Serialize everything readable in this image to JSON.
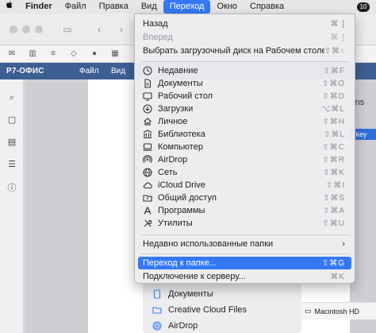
{
  "menubar": {
    "app": "Finder",
    "items": [
      "Файл",
      "Правка",
      "Вид",
      "Переход",
      "Окно",
      "Справка"
    ],
    "badge": "10"
  },
  "toolbar": {
    "r7_logo": "Р7-ОФИС",
    "r7_file": "Файл",
    "r7_view": "Вид"
  },
  "background": {
    "right_text": "cens",
    "right_badge": "ckey",
    "sidebar_peek": [
      "Документы",
      "Creative Cloud Files",
      "AirDrop"
    ],
    "path_peek": "Macintosh HD"
  },
  "go_menu": {
    "items": [
      {
        "label": "Назад",
        "shortcut": "⌘ [",
        "disabled": false,
        "icon": ""
      },
      {
        "label": "Вперед",
        "shortcut": "⌘ ]",
        "disabled": true,
        "icon": ""
      },
      {
        "label": "Выбрать загрузочный диск на Рабочем столе",
        "shortcut": "⇧⌘↑",
        "disabled": false,
        "icon": ""
      },
      {
        "label": "Недавние",
        "shortcut": "⇧⌘F",
        "disabled": false,
        "icon": "clock-icon"
      },
      {
        "label": "Документы",
        "shortcut": "⇧⌘O",
        "disabled": false,
        "icon": "document-icon"
      },
      {
        "label": "Рабочий стол",
        "shortcut": "⇧⌘D",
        "disabled": false,
        "icon": "desktop-icon"
      },
      {
        "label": "Загрузки",
        "shortcut": "⌥⌘L",
        "disabled": false,
        "icon": "download-icon"
      },
      {
        "label": "Личное",
        "shortcut": "⇧⌘H",
        "disabled": false,
        "icon": "home-icon"
      },
      {
        "label": "Библиотека",
        "shortcut": "⇧⌘L",
        "disabled": false,
        "icon": "library-icon"
      },
      {
        "label": "Компьютер",
        "shortcut": "⇧⌘C",
        "disabled": false,
        "icon": "computer-icon"
      },
      {
        "label": "AirDrop",
        "shortcut": "⇧⌘R",
        "disabled": false,
        "icon": "airdrop-icon"
      },
      {
        "label": "Сеть",
        "shortcut": "⇧⌘K",
        "disabled": false,
        "icon": "network-icon"
      },
      {
        "label": "iCloud Drive",
        "shortcut": "⇧⌘I",
        "disabled": false,
        "icon": "cloud-icon"
      },
      {
        "label": "Общий доступ",
        "shortcut": "⇧⌘S",
        "disabled": false,
        "icon": "shared-folder-icon"
      },
      {
        "label": "Программы",
        "shortcut": "⇧⌘A",
        "disabled": false,
        "icon": "applications-icon"
      },
      {
        "label": "Утилиты",
        "shortcut": "⇧⌘U",
        "disabled": false,
        "icon": "utilities-icon"
      }
    ],
    "recent_folders": "Недавно использованные папки",
    "goto_folder": {
      "label": "Переход к папке...",
      "shortcut": "⇧⌘G"
    },
    "connect_server": {
      "label": "Подключение к серверу...",
      "shortcut": "⌘K"
    },
    "colors": {
      "highlight": "#3478f6",
      "r7_blue": "#3d5f93"
    }
  }
}
